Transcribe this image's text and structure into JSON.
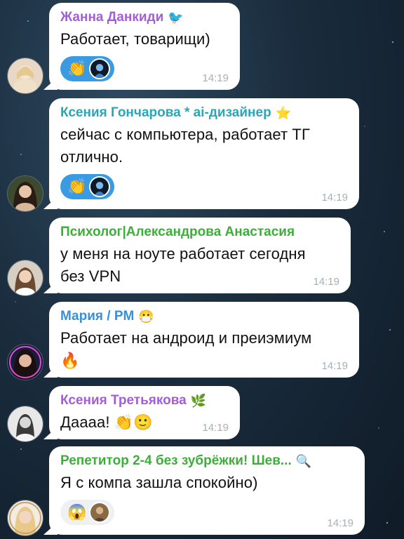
{
  "colors": {
    "purple": "#a35ed6",
    "teal": "#2aa6b8",
    "green": "#3eae3b",
    "blue": "#3a8fd9"
  },
  "messages": [
    {
      "sender": "Жанна Данкиди",
      "sender_emoji": "🐦",
      "text": "Работает, товарищи)",
      "reactions": [
        "👏"
      ],
      "time": "14:19"
    },
    {
      "sender": "Ксения Гончарова * ai-дизайнер",
      "sender_emoji": "⭐",
      "text_line1": "сейчас с компьютера, работает ТГ",
      "text_line2": "отлично.",
      "reactions": [
        "👏"
      ],
      "time": "14:19"
    },
    {
      "sender": "Психолог|Александрова Анастасия",
      "text_line1": "у меня на ноуте работает сегодня",
      "text_line2": "без VPN",
      "time": "14:19"
    },
    {
      "sender": "Мария / PM",
      "sender_emoji": "😷",
      "text_line1": "Работает на андроид и преиэмиум",
      "text_line2": "🔥",
      "time": "14:19"
    },
    {
      "sender": "Ксения Третьякова",
      "sender_emoji": "🌿",
      "text": "Даааа!",
      "text_emoji": "👏🙂",
      "time": "14:19"
    },
    {
      "sender": "Репетитор 2-4 без зубрёжки! Шев...",
      "sender_emoji": "🔍",
      "text": "Я с компа зашла спокойно)",
      "reactions": [
        "😱"
      ],
      "time": "14:19"
    }
  ]
}
